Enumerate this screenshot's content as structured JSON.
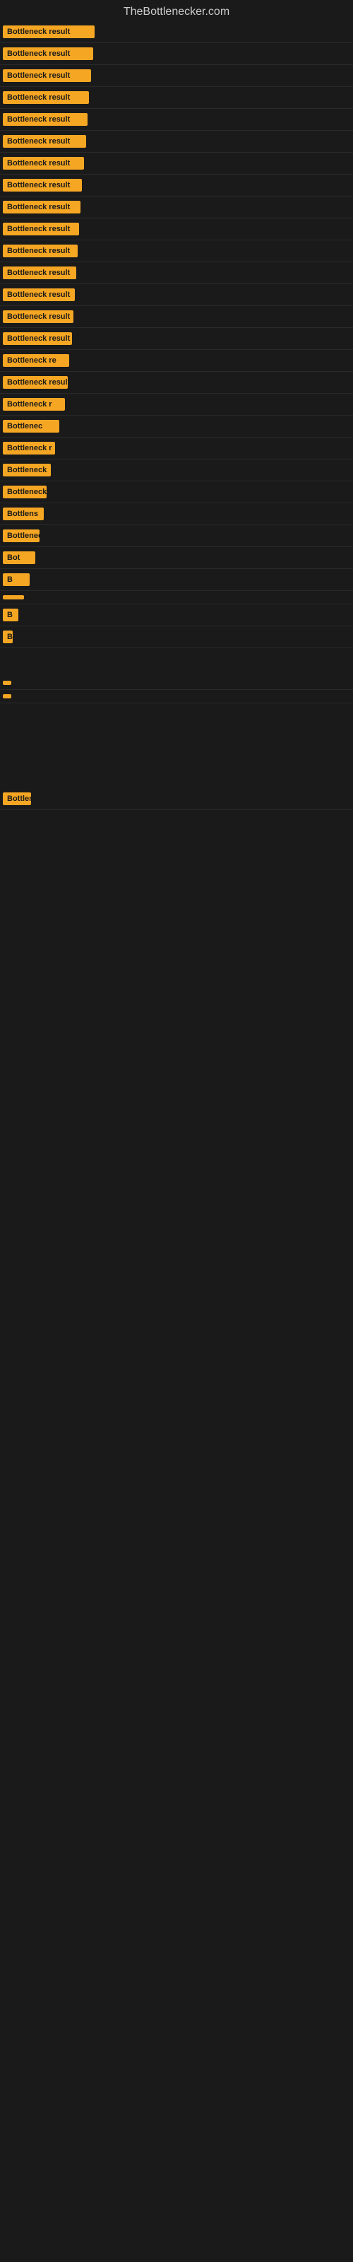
{
  "site": {
    "title": "TheBottlenecker.com"
  },
  "items": [
    {
      "label": "Bottleneck result"
    },
    {
      "label": "Bottleneck result"
    },
    {
      "label": "Bottleneck result"
    },
    {
      "label": "Bottleneck result"
    },
    {
      "label": "Bottleneck result"
    },
    {
      "label": "Bottleneck result"
    },
    {
      "label": "Bottleneck result"
    },
    {
      "label": "Bottleneck result"
    },
    {
      "label": "Bottleneck result"
    },
    {
      "label": "Bottleneck result"
    },
    {
      "label": "Bottleneck result"
    },
    {
      "label": "Bottleneck result"
    },
    {
      "label": "Bottleneck result"
    },
    {
      "label": "Bottleneck result"
    },
    {
      "label": "Bottleneck result"
    },
    {
      "label": "Bottleneck re"
    },
    {
      "label": "Bottleneck result"
    },
    {
      "label": "Bottleneck r"
    },
    {
      "label": "Bottlenec"
    },
    {
      "label": "Bottleneck r"
    },
    {
      "label": "Bottleneck"
    },
    {
      "label": "Bottleneck res"
    },
    {
      "label": "Bottlens"
    },
    {
      "label": "Bottleneck"
    },
    {
      "label": "Bot"
    },
    {
      "label": "B"
    },
    {
      "label": ""
    },
    {
      "label": "B"
    },
    {
      "label": "Bott"
    },
    {
      "label": ""
    },
    {
      "label": ""
    },
    {
      "label": "Bottleneck result"
    }
  ]
}
